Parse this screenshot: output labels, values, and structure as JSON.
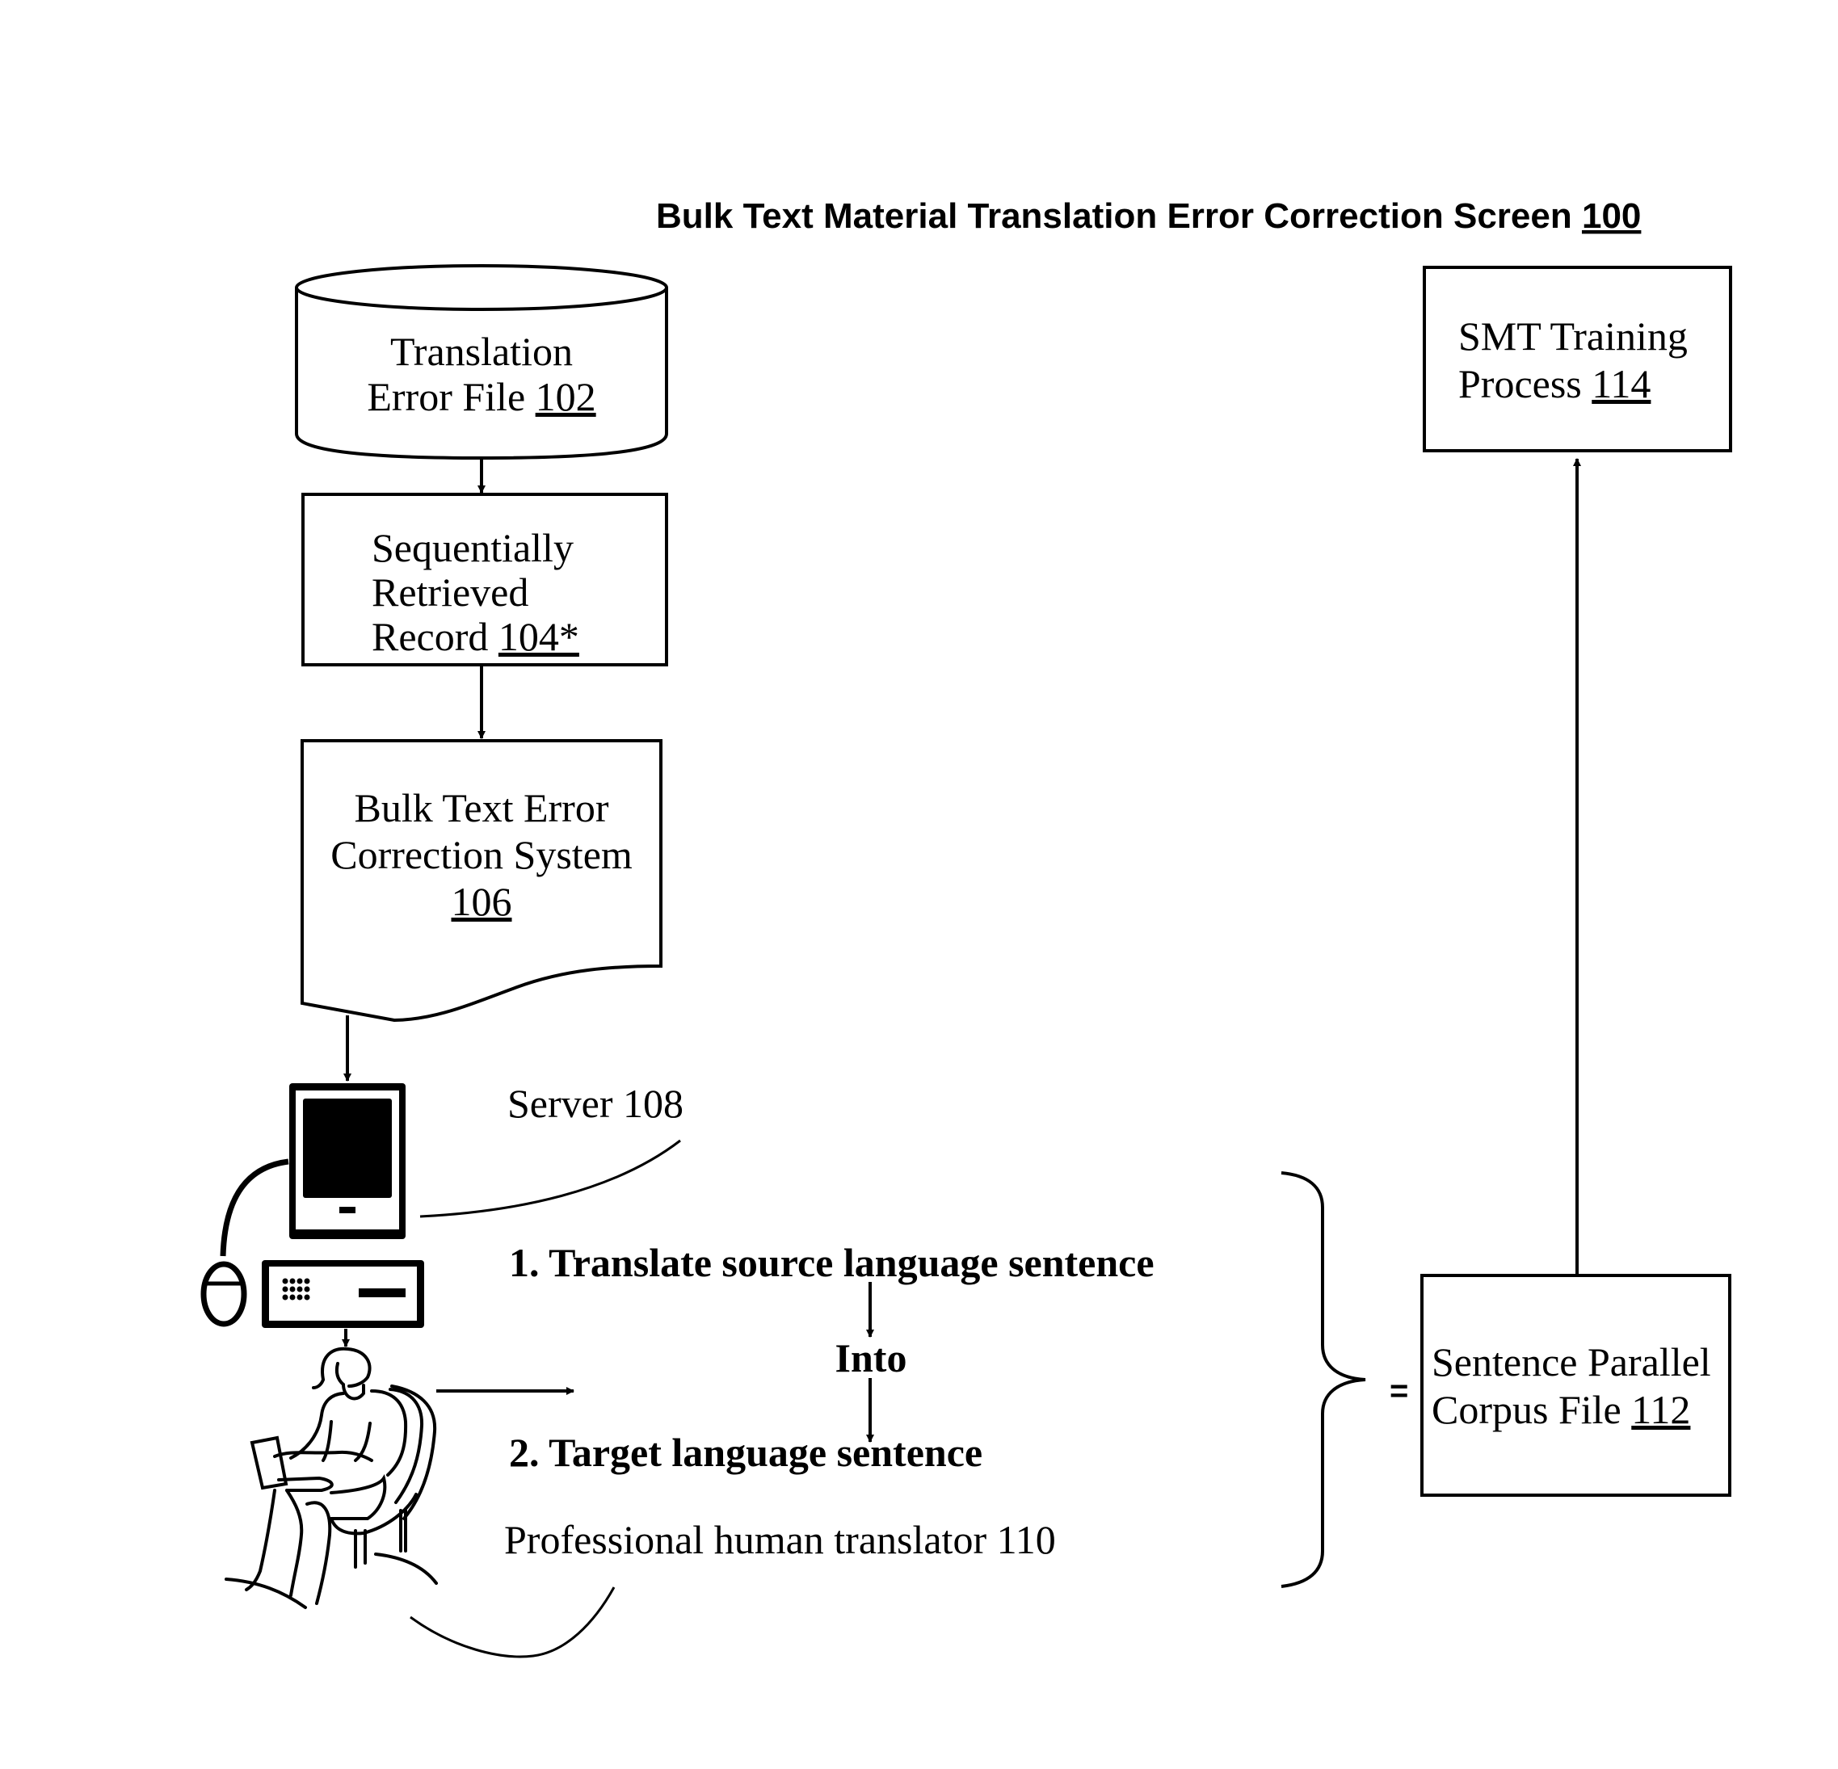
{
  "title": {
    "text": "Bulk Text Material Translation Error Correction Screen",
    "ref": "100"
  },
  "nodes": {
    "error_file": {
      "lines": [
        "Translation",
        "Error File"
      ],
      "ref": "102",
      "shape": "cylinder"
    },
    "record": {
      "lines": [
        "Sequentially",
        "Retrieved",
        "Record"
      ],
      "ref": "104*",
      "shape": "rectangle"
    },
    "correction_system": {
      "lines": [
        "Bulk Text Error",
        "Correction System"
      ],
      "ref": "106",
      "shape": "document"
    },
    "server": {
      "label": "Server 108",
      "icon": "computer-icon"
    },
    "translator": {
      "label": "Professional human translator 110",
      "icon": "person-at-laptop-icon"
    },
    "corpus_file": {
      "lines": [
        "Sentence Parallel",
        "Corpus File"
      ],
      "ref": "112",
      "shape": "rectangle"
    },
    "smt_training": {
      "lines": [
        "SMT Training",
        "Process"
      ],
      "ref": "114",
      "shape": "rectangle"
    }
  },
  "steps": {
    "step1": "1. Translate source language sentence",
    "into": "Into",
    "step2": "2. Target language sentence"
  },
  "equals": "="
}
